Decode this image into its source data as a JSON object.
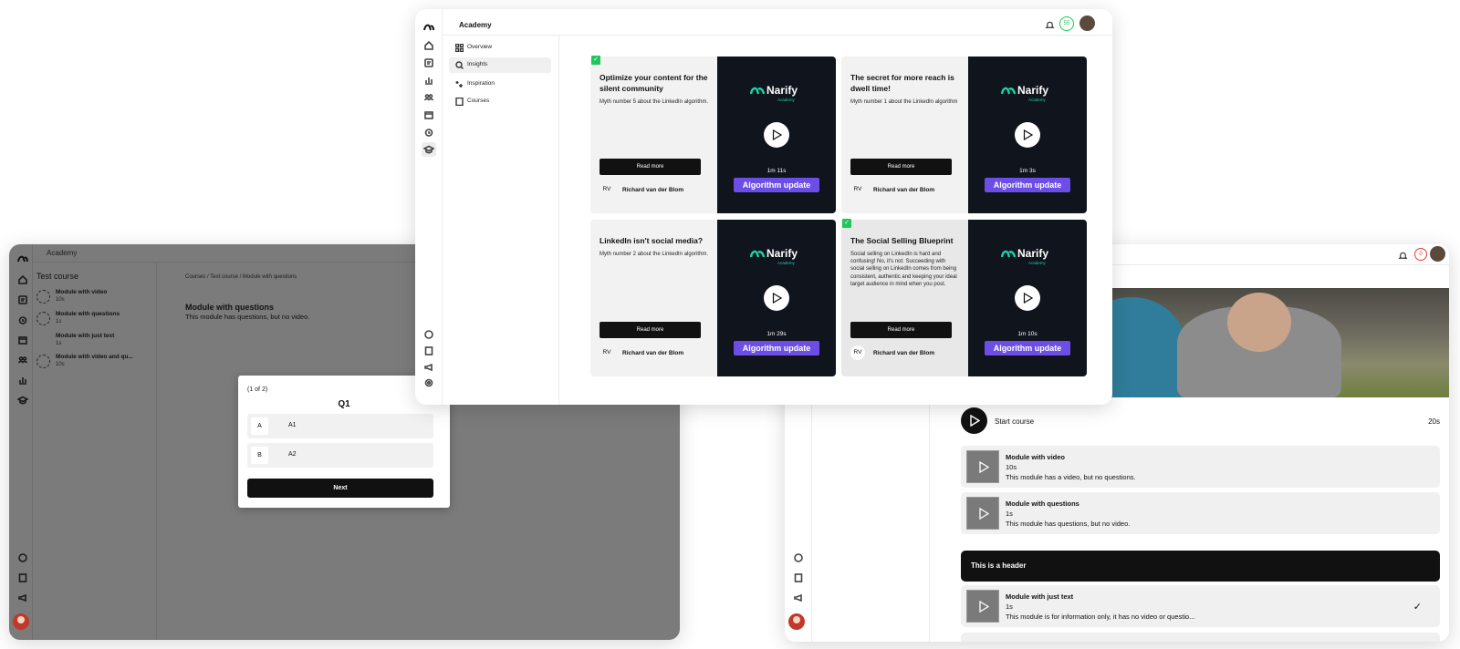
{
  "left_window": {
    "app_title": "Academy",
    "course_title": "Test course",
    "modules": [
      {
        "title": "Module with video",
        "duration": "10s"
      },
      {
        "title": "Module with questions",
        "duration": "1s"
      },
      {
        "title": "Module with just text",
        "duration": "1s"
      },
      {
        "title": "Module with video and qu...",
        "duration": "10s"
      }
    ],
    "breadcrumb": "Courses / Test course / Module with questions",
    "module_heading": "Module with questions",
    "module_description": "This module has questions, but no video.",
    "quiz": {
      "count": "(1 of 2)",
      "question": "Q1",
      "options": [
        {
          "key": "A",
          "value": "A1"
        },
        {
          "key": "B",
          "value": "A2"
        }
      ],
      "next_label": "Next"
    }
  },
  "center_window": {
    "app_title": "Academy",
    "nav": [
      {
        "label": "Overview",
        "icon": "grid-icon"
      },
      {
        "label": "Insights",
        "icon": "search-icon"
      },
      {
        "label": "Inspiration",
        "icon": "sparkle-icon"
      },
      {
        "label": "Courses",
        "icon": "book-icon"
      }
    ],
    "score_badge": "55",
    "brand": {
      "name": "Narify",
      "sub": "Academy"
    },
    "cards": [
      {
        "title": "Optimize your content for the silent community",
        "description": "Myth number 5 about the LinkedIn algorithm.",
        "read_more": "Read more",
        "initials": "RV",
        "author": "Richard van der Blom",
        "duration": "1m 11s",
        "tag": "Algorithm update"
      },
      {
        "title": "The secret for more reach is dwell time!",
        "description": "Myth number 1 about the LinkedIn algorithm",
        "read_more": "Read more",
        "initials": "RV",
        "author": "Richard van der Blom",
        "duration": "1m 3s",
        "tag": "Algorithm update"
      },
      {
        "title": "LinkedIn isn't social media?",
        "description": "Myth number 2 about the LinkedIn algorithm.",
        "read_more": "Read more",
        "initials": "RV",
        "author": "Richard van der Blom",
        "duration": "1m 29s",
        "tag": "Algorithm update"
      },
      {
        "title": "The Social Selling Blueprint",
        "description": "Social selling on LinkedIn is hard and confusing! No, it's not. Succeeding with social selling on LinkedIn comes from being consistent, authentic and keeping your ideal target audience in mind when you post.",
        "read_more": "Read more",
        "initials": "RV",
        "author": "Richard van der Blom",
        "duration": "1m 10s",
        "tag": "Algorithm update"
      }
    ],
    "seen_mark": "✓"
  },
  "right_window": {
    "score_badge": "0",
    "start": {
      "label": "Start course",
      "duration": "20s"
    },
    "modules": [
      {
        "title": "Module with video",
        "duration": "10s",
        "description": "This module has a video, but no questions."
      },
      {
        "title": "Module with questions",
        "duration": "1s",
        "description": "This module has questions, but no video."
      }
    ],
    "section_header": "This is a header",
    "module_text": {
      "title": "Module with just text",
      "duration": "1s",
      "description": "This module is for information only, it has no video or questio...",
      "done_mark": "✓"
    }
  },
  "colors": {
    "brand_accent": "#17d4a8",
    "tag_purple": "#6c4ee6",
    "dark": "#10141d",
    "seen_green": "#22c55e"
  }
}
